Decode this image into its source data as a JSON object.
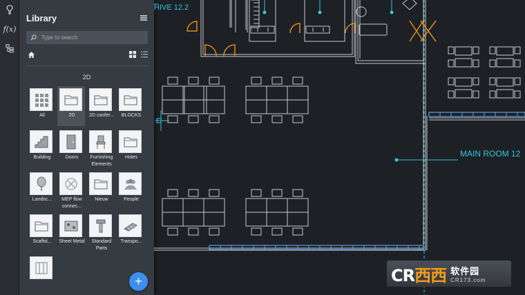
{
  "rail": {
    "items": [
      {
        "icon": "pin-icon"
      },
      {
        "icon": "function-icon",
        "label": "f(x)"
      },
      {
        "icon": "layers-tree-icon"
      }
    ]
  },
  "library": {
    "title": "Library",
    "search_placeholder": "Type to search",
    "section": "2D",
    "tiles": [
      {
        "name": "all",
        "label": "All",
        "icon": "grid-icon"
      },
      {
        "name": "2d",
        "label": "2D",
        "icon": "folder-icon",
        "selected": true
      },
      {
        "name": "2d-conference",
        "label": "2D confer...",
        "icon": "folder-icon"
      },
      {
        "name": "blocks",
        "label": "BLOCKS",
        "icon": "folder-icon"
      },
      {
        "name": "building",
        "label": "Building",
        "icon": "stairs-icon"
      },
      {
        "name": "doors",
        "label": "Doors",
        "icon": "door-icon"
      },
      {
        "name": "furnishing",
        "label": "Furnishing Elements",
        "icon": "chair-icon"
      },
      {
        "name": "holes",
        "label": "Holes",
        "icon": "folder-icon"
      },
      {
        "name": "landscape",
        "label": "Landsc...",
        "icon": "tree-icon"
      },
      {
        "name": "mep",
        "label": "MEP flow connec...",
        "icon": "mep-icon"
      },
      {
        "name": "nieuw",
        "label": "Nieuw",
        "icon": "folder-icon"
      },
      {
        "name": "people",
        "label": "People",
        "icon": "people-icon"
      },
      {
        "name": "scaffold",
        "label": "Scaffol...",
        "icon": "folder-icon"
      },
      {
        "name": "sheet-metal",
        "label": "Sheet Metal",
        "icon": "sheet-metal-icon"
      },
      {
        "name": "standard-parts",
        "label": "Standard Parts",
        "icon": "bolt-icon"
      },
      {
        "name": "transport",
        "label": "Transpo...",
        "icon": "conveyor-icon"
      },
      {
        "name": "more",
        "label": "",
        "icon": "window-icon"
      }
    ],
    "add_label": "+"
  },
  "canvas": {
    "labels": {
      "archive": "HIVE 12.2",
      "main_room": "MAIN ROOM 12"
    },
    "colors": {
      "background": "#1d2024",
      "lines": "#c8cbcf",
      "cyan": "#33c8dc",
      "orange": "#e08a1e",
      "blue_wall": "#5aa0e8"
    }
  },
  "watermark": {
    "logo": "CR",
    "logo_accent": "西西",
    "cn": "软件园",
    "url": "CR173.com"
  }
}
